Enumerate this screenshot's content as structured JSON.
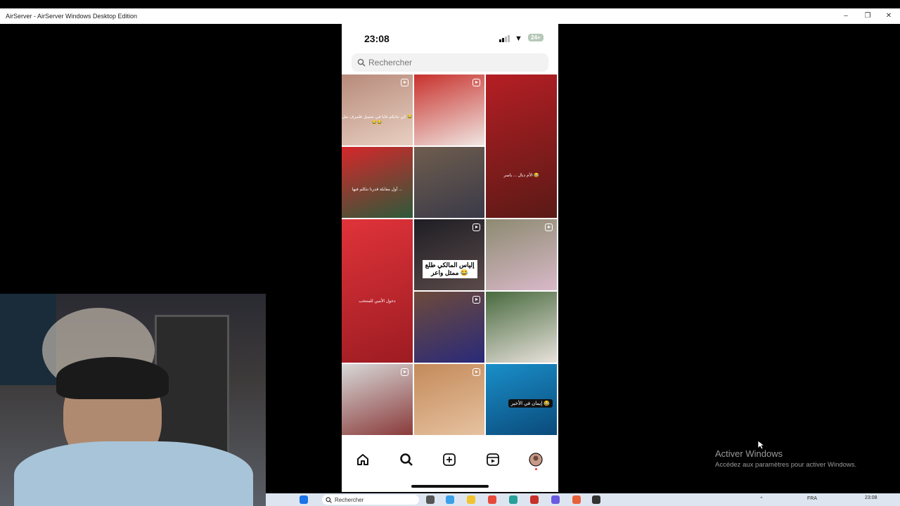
{
  "window": {
    "title": "AirServer - AirServer Windows Desktop Edition",
    "minimize_icon": "minimize-icon",
    "maximize_icon": "restore-icon",
    "close_icon": "close-icon"
  },
  "phone": {
    "status": {
      "time": "23:08",
      "battery": "24+"
    },
    "search": {
      "placeholder": "Rechercher",
      "icon": "search-icon"
    },
    "tiles": [
      {
        "caption": "كي جانكم غايا\nفي تحميل قلمرف نقل 😂😂😂",
        "reel": true,
        "colors": [
          "#b78a7a",
          "#e9d0c2"
        ]
      },
      {
        "caption": "",
        "reel": true,
        "colors": [
          "#c8312c",
          "#f0e6e2"
        ]
      },
      {
        "caption": "",
        "reel": false,
        "colors": [
          "#b51e24",
          "#5a1a16"
        ]
      },
      {
        "caption": "أول مقابلة قدرنا نتكلم فيها ... ",
        "reel": false,
        "colors": [
          "#d6272b",
          "#2d5a3a"
        ]
      },
      {
        "caption": "",
        "reel": false,
        "colors": [
          "#6f5d4e",
          "#3a3a48"
        ]
      },
      {
        "caption": "الأم ديال ... ياسر 😂",
        "reel": false,
        "colors": [
          "#3d0e12",
          "#8a1d24"
        ]
      },
      {
        "caption": "دخول الأمين للمنتخب",
        "reel": false,
        "colors": [
          "#e0333a",
          "#9c1c22"
        ]
      },
      {
        "caption": "إلياس المالكي طلع ممثل واعر 😂",
        "reel": true,
        "colors": [
          "#1e1e24",
          "#5b4a4a"
        ]
      },
      {
        "caption": "",
        "reel": true,
        "colors": [
          "#8c8a70",
          "#d9b9c9"
        ]
      },
      {
        "caption": "",
        "reel": true,
        "colors": [
          "#6d4a3a",
          "#2a2a7a"
        ]
      },
      {
        "caption": "",
        "reel": false,
        "colors": [
          "#486a3e",
          "#e9e2dc"
        ]
      },
      {
        "caption": "",
        "reel": true,
        "colors": [
          "#d8d8d8",
          "#8a3a3a"
        ]
      },
      {
        "caption": "",
        "reel": true,
        "colors": [
          "#c48a5a",
          "#e6c2a0"
        ]
      },
      {
        "caption": "إيمان في الأخير 😂",
        "reel": false,
        "colors": [
          "#1a8fc9",
          "#0a4a7a"
        ]
      }
    ],
    "nav": [
      "home-icon",
      "search-icon",
      "create-icon",
      "reels-icon",
      "profile-avatar"
    ]
  },
  "taskbar": {
    "search_label": "Rechercher",
    "language": "FRA",
    "clock": "23:08"
  },
  "watermark": {
    "title": "Activer Windows",
    "subtitle": "Accédez aux paramètres pour activer Windows."
  }
}
